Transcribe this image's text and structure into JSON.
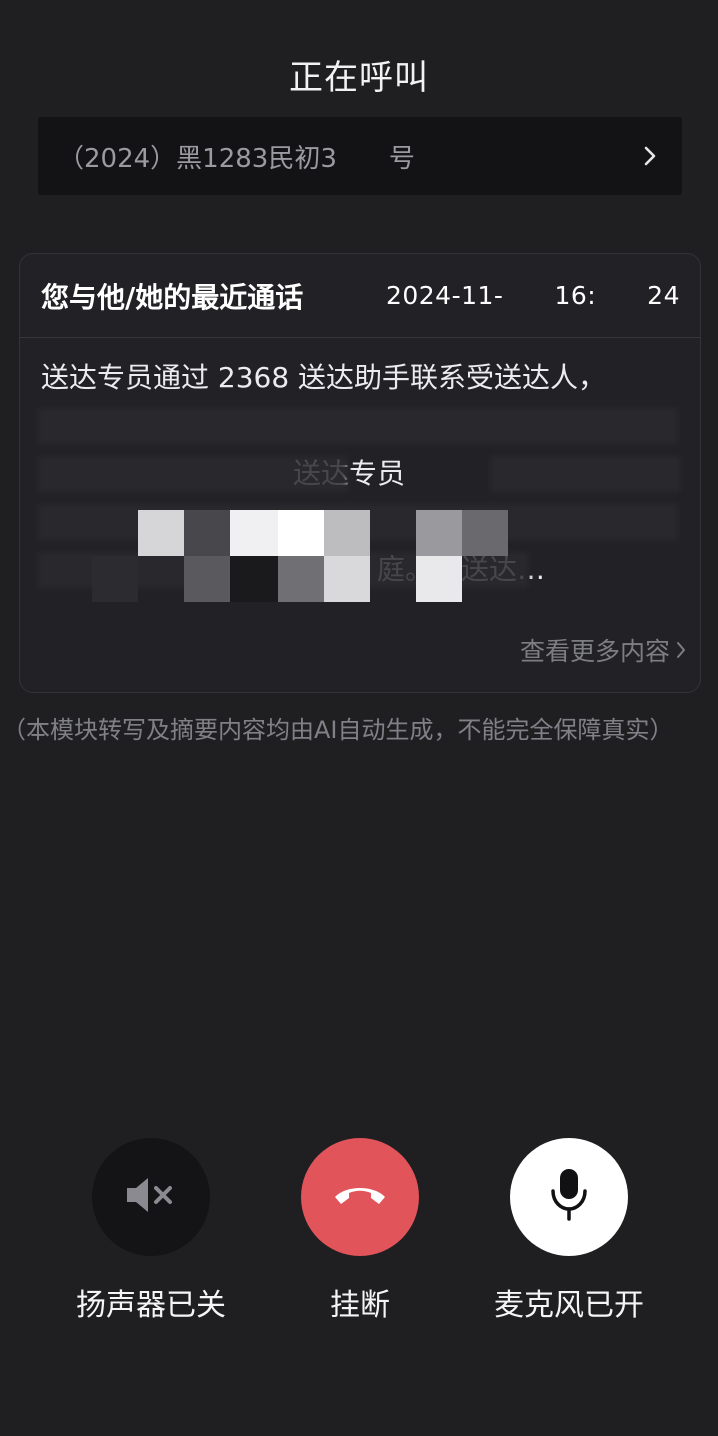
{
  "header": {
    "title": "正在呼叫"
  },
  "case_bar": {
    "case_number": "（2024）黑1283民初3  号",
    "chevron_icon": "chevron-right-icon"
  },
  "recent_call": {
    "title": "您与他/她的最近通话",
    "date": "2024-11-  16:  24",
    "lines": [
      "送达专员通过 2368 送达助手联系受送达人，",
      "",
      "　　　　　　　　　送达专员",
      "",
      "　　　　　　　　　　　　庭。受送达…"
    ],
    "more_label": "查看更多内容"
  },
  "disclaimer": "（本模块转写及摘要内容均由AI自动生成，不能完全保障真实）",
  "controls": {
    "speaker": {
      "label": "扬声器已关",
      "icon": "speaker-muted-icon",
      "bg": "#141417"
    },
    "hangup": {
      "label": "挂断",
      "icon": "phone-hangup-icon",
      "bg": "#e0545a"
    },
    "mic": {
      "label": "麦克风已开",
      "icon": "microphone-icon",
      "bg": "#ffffff"
    }
  }
}
